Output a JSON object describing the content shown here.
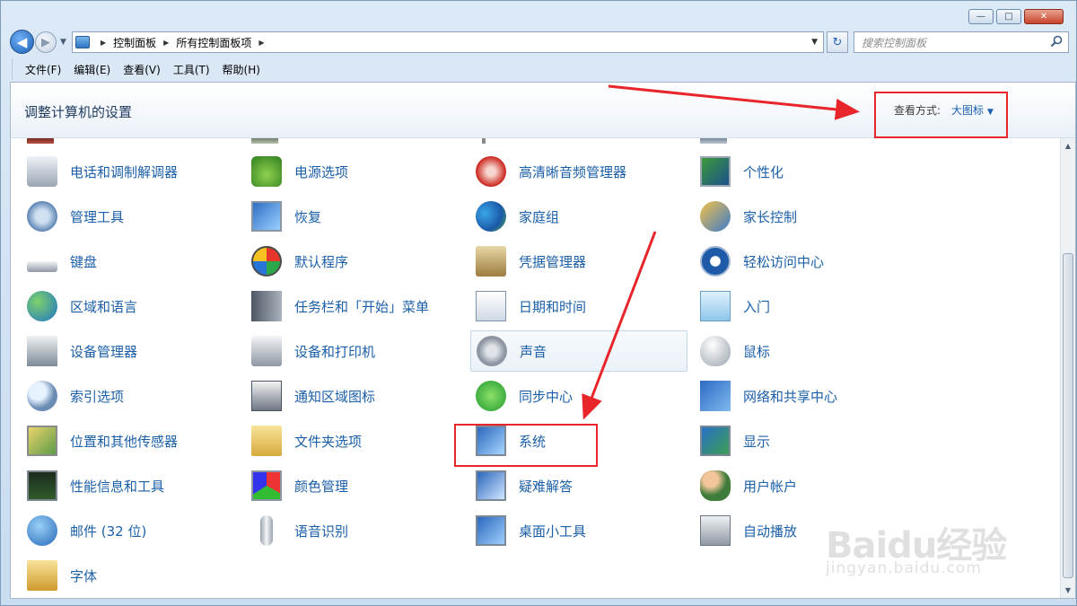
{
  "window": {
    "minimize": "—",
    "maximize": "□",
    "close": "✕"
  },
  "nav": {
    "breadcrumb": [
      "控制面板",
      "所有控制面板项"
    ],
    "search_placeholder": "搜索控制面板"
  },
  "menu": [
    "文件(F)",
    "编辑(E)",
    "查看(V)",
    "工具(T)",
    "帮助(H)"
  ],
  "header": {
    "title": "调整计算机的设置",
    "view_by_label": "查看方式:",
    "view_by_value": "大图标"
  },
  "items": [
    [
      "电话和调制解调器",
      "电源选项",
      "高清晰音频管理器",
      "个性化"
    ],
    [
      "管理工具",
      "恢复",
      "家庭组",
      "家长控制"
    ],
    [
      "键盘",
      "默认程序",
      "凭据管理器",
      "轻松访问中心"
    ],
    [
      "区域和语言",
      "任务栏和「开始」菜单",
      "日期和时间",
      "入门"
    ],
    [
      "设备管理器",
      "设备和打印机",
      "声音",
      "鼠标"
    ],
    [
      "索引选项",
      "通知区域图标",
      "同步中心",
      "网络和共享中心"
    ],
    [
      "位置和其他传感器",
      "文件夹选项",
      "系统",
      "显示"
    ],
    [
      "性能信息和工具",
      "颜色管理",
      "疑难解答",
      "用户帐户"
    ],
    [
      "邮件 (32 位)",
      "语音识别",
      "桌面小工具",
      "自动播放"
    ],
    [
      "字体"
    ]
  ],
  "icons": [
    [
      "phone-modem-icon",
      "power-options-icon",
      "hd-audio-manager-icon",
      "personalization-icon"
    ],
    [
      "admin-tools-icon",
      "recovery-icon",
      "homegroup-icon",
      "parental-controls-icon"
    ],
    [
      "keyboard-icon",
      "default-programs-icon",
      "credential-manager-icon",
      "ease-of-access-icon"
    ],
    [
      "region-language-icon",
      "taskbar-start-menu-icon",
      "date-time-icon",
      "getting-started-icon"
    ],
    [
      "device-manager-icon",
      "devices-printers-icon",
      "sound-icon",
      "mouse-icon"
    ],
    [
      "indexing-options-icon",
      "notification-area-icon",
      "sync-center-icon",
      "network-sharing-icon"
    ],
    [
      "location-sensors-icon",
      "folder-options-icon",
      "system-icon",
      "display-icon"
    ],
    [
      "performance-tools-icon",
      "color-management-icon",
      "troubleshooting-icon",
      "user-accounts-icon"
    ],
    [
      "mail-icon",
      "speech-recognition-icon",
      "desktop-gadgets-icon",
      "autoplay-icon"
    ],
    [
      "fonts-icon"
    ]
  ],
  "hovered_item": "声音",
  "highlighted_item": "系统",
  "watermark": {
    "logo": "Baidu经验",
    "url": "jingyan.baidu.com"
  }
}
